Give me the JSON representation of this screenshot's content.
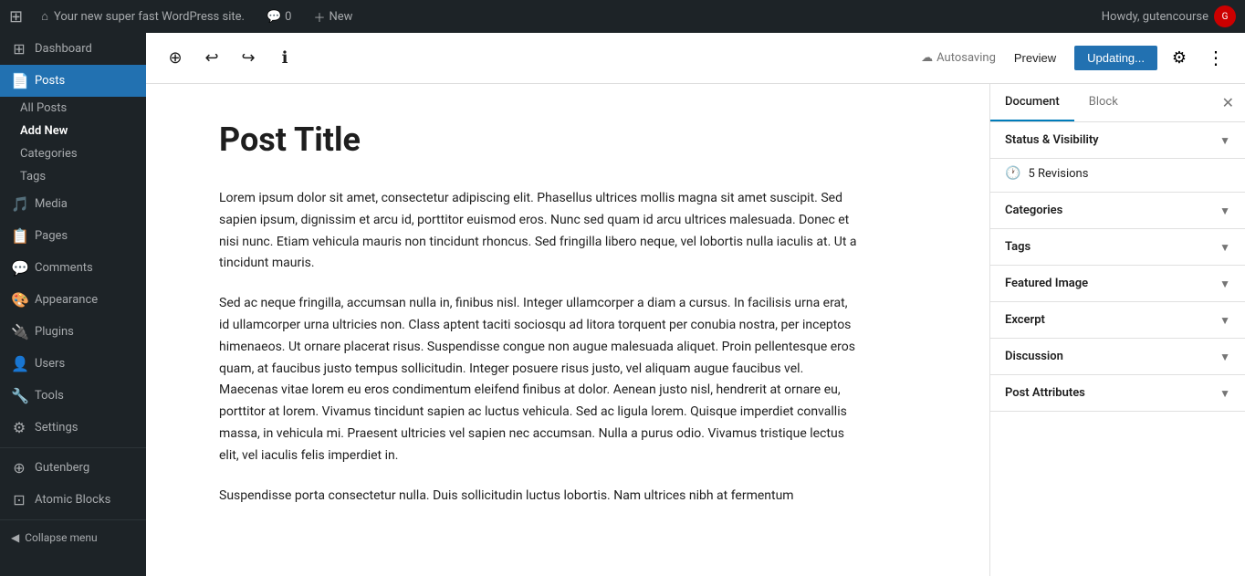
{
  "admin_bar": {
    "wp_logo": "⊞",
    "site_name": "Your new super fast WordPress site.",
    "home_icon": "⌂",
    "comments_icon": "💬",
    "comments_count": "0",
    "new_label": "New",
    "howdy": "Howdy, gutencourse",
    "avatar_initials": "G"
  },
  "sidebar": {
    "dashboard_label": "Dashboard",
    "posts_label": "Posts",
    "all_posts_label": "All Posts",
    "add_new_label": "Add New",
    "categories_label": "Categories",
    "tags_label": "Tags",
    "media_label": "Media",
    "pages_label": "Pages",
    "comments_label": "Comments",
    "appearance_label": "Appearance",
    "plugins_label": "Plugins",
    "users_label": "Users",
    "tools_label": "Tools",
    "settings_label": "Settings",
    "gutenberg_label": "Gutenberg",
    "atomic_blocks_label": "Atomic Blocks",
    "collapse_label": "Collapse menu"
  },
  "toolbar": {
    "add_block_title": "+",
    "undo_title": "↩",
    "redo_title": "↪",
    "info_title": "ℹ",
    "autosave_label": "Autosaving",
    "preview_label": "Preview",
    "update_label": "Updating...",
    "settings_icon": "⚙",
    "more_icon": "⋮"
  },
  "editor": {
    "post_title": "Post Title",
    "paragraph1": "Lorem ipsum dolor sit amet, consectetur adipiscing elit. Phasellus ultrices mollis magna sit amet suscipit. Sed sapien ipsum, dignissim et arcu id, porttitor euismod eros. Nunc sed quam id arcu ultrices malesuada. Donec et nisi nunc. Etiam vehicula mauris non tincidunt rhoncus. Sed fringilla libero neque, vel lobortis nulla iaculis at. Ut a tincidunt mauris.",
    "paragraph2": "Sed ac neque fringilla, accumsan nulla in, finibus nisl. Integer ullamcorper a diam a cursus. In facilisis urna erat, id ullamcorper urna ultricies non. Class aptent taciti sociosqu ad litora torquent per conubia nostra, per inceptos himenaeos. Ut ornare placerat risus. Suspendisse congue non augue malesuada aliquet. Proin pellentesque eros quam, at faucibus justo tempus sollicitudin. Integer posuere risus justo, vel aliquam augue faucibus vel. Maecenas vitae lorem eu eros condimentum eleifend finibus at dolor. Aenean justo nisl, hendrerit at ornare eu, porttitor at lorem. Vivamus tincidunt sapien ac luctus vehicula. Sed ac ligula lorem. Quisque imperdiet convallis massa, in vehicula mi. Praesent ultricies vel sapien nec accumsan. Nulla a purus odio. Vivamus tristique lectus elit, vel iaculis felis imperdiet in.",
    "paragraph3": "Suspendisse porta consectetur nulla. Duis sollicitudin luctus lobortis. Nam ultrices nibh at fermentum"
  },
  "panel": {
    "document_tab": "Document",
    "block_tab": "Block",
    "close_icon": "✕",
    "status_visibility_label": "Status & Visibility",
    "revisions_label": "5 Revisions",
    "revisions_icon": "🕐",
    "categories_label": "Categories",
    "tags_label": "Tags",
    "featured_image_label": "Featured Image",
    "excerpt_label": "Excerpt",
    "discussion_label": "Discussion",
    "post_attributes_label": "Post Attributes"
  }
}
